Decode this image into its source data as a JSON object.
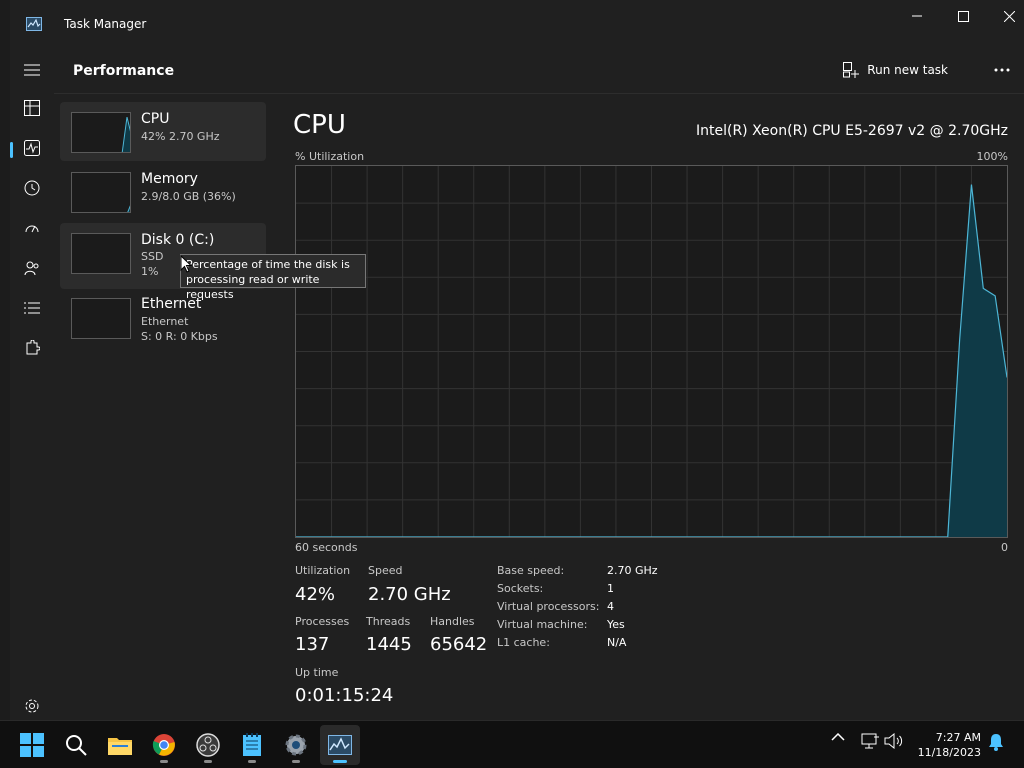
{
  "app": {
    "title": "Task Manager"
  },
  "header": {
    "title": "Performance",
    "run_new_task": "Run new task"
  },
  "devices": [
    {
      "name": "CPU",
      "line1": "42% 2.70 GHz",
      "line2": ""
    },
    {
      "name": "Memory",
      "line1": "2.9/8.0 GB (36%)",
      "line2": ""
    },
    {
      "name": "Disk 0 (C:)",
      "line1": "SSD",
      "line2": "1%"
    },
    {
      "name": "Ethernet",
      "line1": "Ethernet",
      "line2": "S: 0 R: 0 Kbps"
    }
  ],
  "tooltip": {
    "text": "Percentage of time the disk is processing read or write requests"
  },
  "main": {
    "title": "CPU",
    "model": "Intel(R) Xeon(R) CPU E5-2697 v2 @ 2.70GHz",
    "util_label": "% Utilization",
    "util_max": "100%",
    "axis_left": "60 seconds",
    "axis_right": "0"
  },
  "stats": {
    "utilization_label": "Utilization",
    "utilization": "42%",
    "speed_label": "Speed",
    "speed": "2.70 GHz",
    "processes_label": "Processes",
    "processes": "137",
    "threads_label": "Threads",
    "threads": "1445",
    "handles_label": "Handles",
    "handles": "65642",
    "uptime_label": "Up time",
    "uptime": "0:01:15:24"
  },
  "specs": [
    {
      "label": "Base speed:",
      "value": "2.70 GHz"
    },
    {
      "label": "Sockets:",
      "value": "1"
    },
    {
      "label": "Virtual processors:",
      "value": "4"
    },
    {
      "label": "Virtual machine:",
      "value": "Yes"
    },
    {
      "label": "L1 cache:",
      "value": "N/A"
    }
  ],
  "cpu_graph": {
    "note": "utilization percent values, oldest to newest, over last 60 seconds",
    "values": [
      0,
      0,
      0,
      0,
      0,
      0,
      0,
      0,
      0,
      0,
      0,
      0,
      0,
      0,
      0,
      0,
      0,
      0,
      0,
      0,
      0,
      0,
      0,
      0,
      0,
      0,
      0,
      0,
      0,
      0,
      0,
      0,
      0,
      0,
      0,
      0,
      0,
      0,
      0,
      0,
      0,
      0,
      0,
      0,
      0,
      0,
      0,
      0,
      0,
      0,
      0,
      0,
      0,
      0,
      0,
      0,
      53,
      95,
      67,
      65,
      43
    ]
  },
  "thumbs": {
    "cpu": [
      0,
      0,
      0,
      0,
      0,
      0,
      0,
      0,
      0,
      0,
      0,
      90,
      40
    ],
    "memory": [
      0,
      0,
      0,
      0,
      0,
      0,
      0,
      0,
      0,
      0,
      0,
      0,
      30
    ]
  },
  "taskbar": {
    "time": "7:27 AM",
    "date": "11/18/2023"
  },
  "colors": {
    "accent": "#4cc2ff",
    "graph_line": "#4db6d6",
    "graph_fill": "#0f3a47"
  }
}
